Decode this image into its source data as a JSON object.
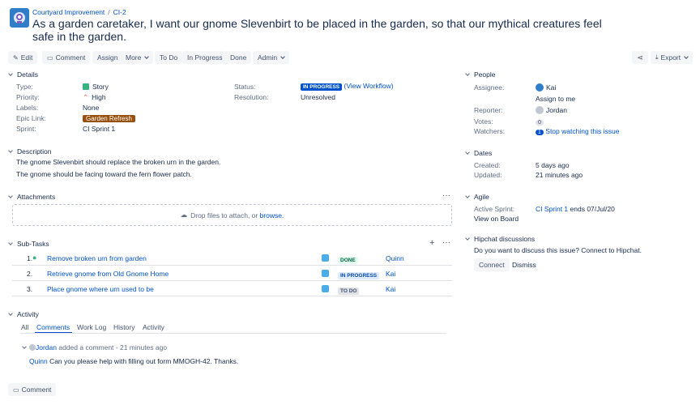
{
  "breadcrumb": {
    "project": "Courtyard Improvement",
    "separator": "/",
    "issue_key": "CI-2"
  },
  "issue": {
    "title": "As a garden caretaker, I want our gnome Slevenbirt to be placed in the garden, so that our mythical creatures feel safe in the garden."
  },
  "toolbar": {
    "edit": "Edit",
    "comment": "Comment",
    "assign": "Assign",
    "more": "More",
    "to_do": "To Do",
    "in_progress": "In Progress",
    "done": "Done",
    "admin": "Admin",
    "export": "Export"
  },
  "details": {
    "heading": "Details",
    "type_label": "Type:",
    "type_value": "Story",
    "priority_label": "Priority:",
    "priority_value": "High",
    "labels_label": "Labels:",
    "labels_value": "None",
    "epic_label": "Epic Link:",
    "epic_value": "Garden Refresh",
    "sprint_label": "Sprint:",
    "sprint_value": "CI Sprint 1",
    "status_label": "Status:",
    "status_value": "IN PROGRESS",
    "workflow_link": "(View Workflow)",
    "resolution_label": "Resolution:",
    "resolution_value": "Unresolved"
  },
  "description": {
    "heading": "Description",
    "line1": "The gnome Slevenbirt should replace the broken urn in the garden.",
    "line2": "The gnome should be facing toward the fern flower patch."
  },
  "attachments": {
    "heading": "Attachments",
    "drop_text": "Drop files to attach, or ",
    "browse": "browse."
  },
  "subtasks": {
    "heading": "Sub-Tasks",
    "rows": [
      {
        "num": "1.",
        "summary": "Remove broken urn from garden",
        "status": "DONE",
        "assignee": "Quinn"
      },
      {
        "num": "2.",
        "summary": "Retrieve gnome from Old Gnome Home",
        "status": "IN PROGRESS",
        "assignee": "Kai"
      },
      {
        "num": "3.",
        "summary": "Place gnome where urn used to be",
        "status": "TO DO",
        "assignee": "Kai"
      }
    ]
  },
  "activity": {
    "heading": "Activity",
    "tabs": [
      "All",
      "Comments",
      "Work Log",
      "History",
      "Activity"
    ],
    "comment_author": "Jordan",
    "comment_meta": "added a comment - 21 minutes ago",
    "comment_mention": "Quinn",
    "comment_body": "Can you please help with filling out form MMOGH-42.  Thanks."
  },
  "comment_button": "Comment",
  "people": {
    "heading": "People",
    "assignee_label": "Assignee:",
    "assignee_value": "Kai",
    "assign_to_me": "Assign to me",
    "reporter_label": "Reporter:",
    "reporter_value": "Jordan",
    "votes_label": "Votes:",
    "votes_value": "0",
    "watchers_label": "Watchers:",
    "watchers_count": "1",
    "watchers_link": "Stop watching this issue"
  },
  "dates": {
    "heading": "Dates",
    "created_label": "Created:",
    "created_value": "5 days ago",
    "updated_label": "Updated:",
    "updated_value": "21 minutes ago"
  },
  "agile": {
    "heading": "Agile",
    "active_sprint_label": "Active Sprint:",
    "sprint_link": "CI Sprint 1",
    "sprint_ends": "ends 07/Jul/20",
    "view_on_board": "View on Board"
  },
  "hipchat": {
    "heading": "Hipchat discussions",
    "prompt": "Do you want to discuss this issue? Connect to Hipchat.",
    "connect": "Connect",
    "dismiss": "Dismiss"
  },
  "colors": {
    "link": "#0052cc",
    "status_blue": "#0052cc",
    "epic_brown": "#974f0c",
    "story_green": "#36b37e"
  }
}
